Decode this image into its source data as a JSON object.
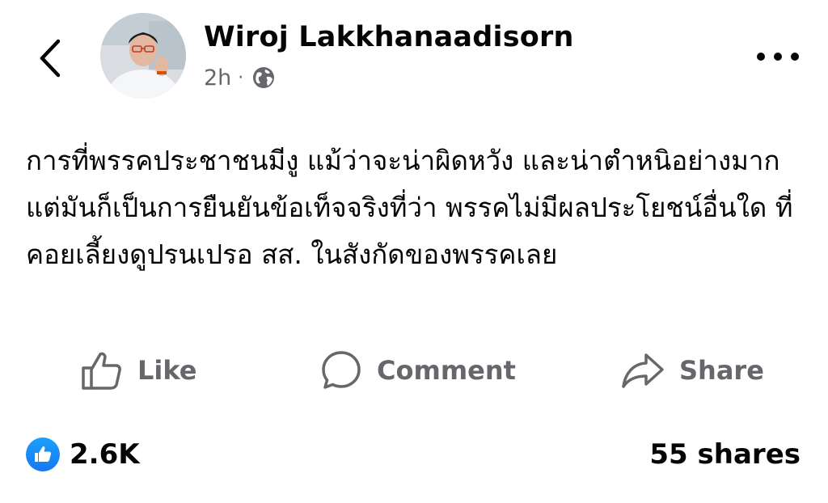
{
  "header": {
    "back_icon": "chevron-left-icon",
    "author_name": "Wiroj Lakkhanaadisorn",
    "time": "2h",
    "separator": "·",
    "audience_icon": "globe-icon",
    "more_icon": "more-horizontal-icon"
  },
  "post": {
    "text": "การที่พรรคประชาชนมีงู แม้ว่าจะน่าผิดหวัง และน่าตำหนิอย่างมาก แต่มันก็เป็นการยืนยันข้อเท็จจริงที่ว่า พรรคไม่มีผลประโยชน์อื่นใด ที่คอยเลี้ยงดูปรนเปรอ สส. ในสังกัดของพรรคเลย"
  },
  "actions": {
    "like_label": "Like",
    "comment_label": "Comment",
    "share_label": "Share"
  },
  "footer": {
    "reaction_count": "2.6K",
    "shares_label": "55 shares"
  },
  "colors": {
    "text_primary": "#050505",
    "text_secondary": "#65676b",
    "accent_blue": "#1877f2"
  }
}
